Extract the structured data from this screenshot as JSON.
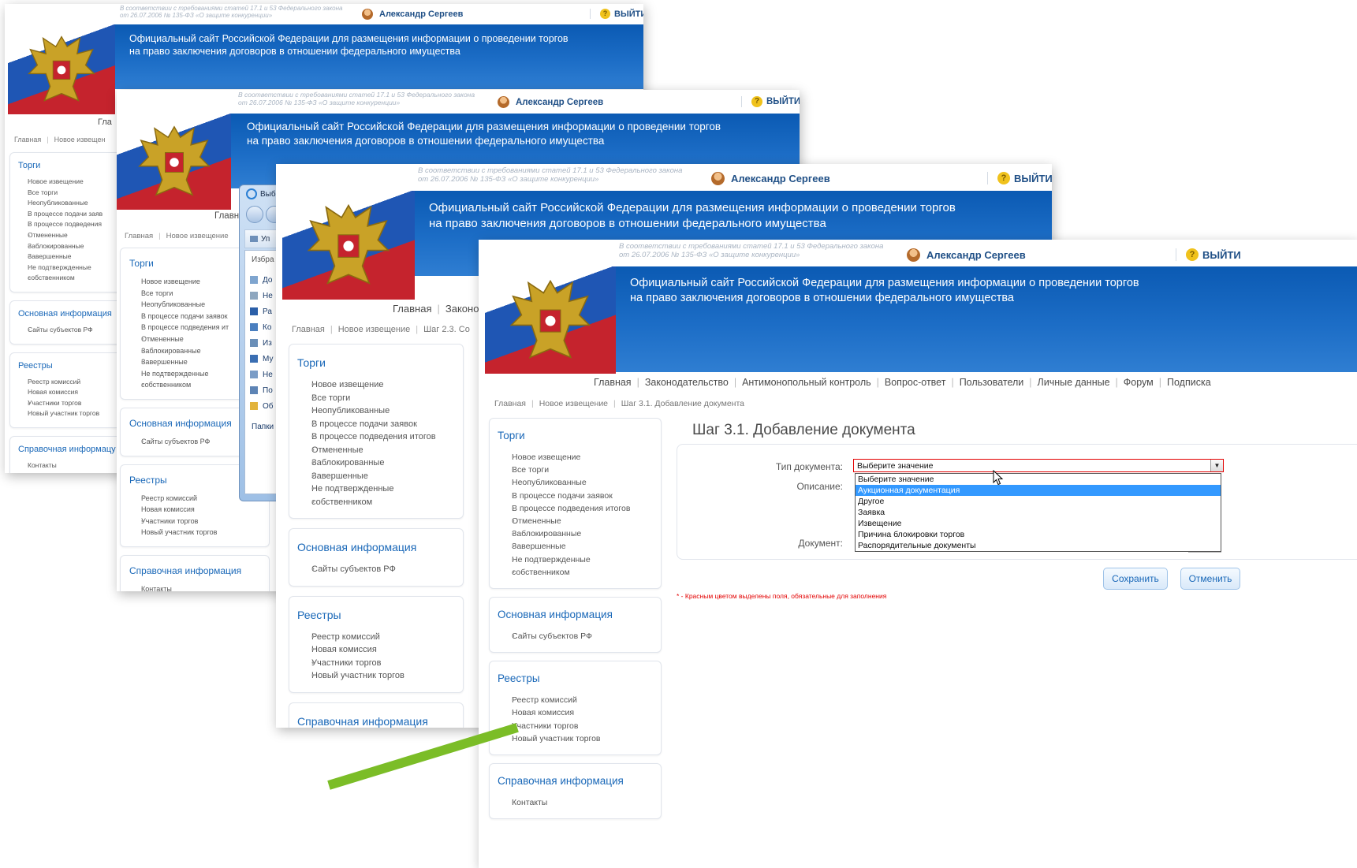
{
  "header": {
    "legal_line1": "В соответствии с требованиями статей 17.1 и 53 Федерального закона",
    "legal_line2": "от 26.07.2006 № 135-ФЗ «О защите конкуренции»",
    "user_name": "Александр Сергеев",
    "logout_label": "ВЫЙТИ",
    "title_line1": "Официальный сайт Российской Федерации для размещения информации о проведении торгов",
    "title_line2": "на право заключения договоров в отношении федерального имущества"
  },
  "nav": [
    "Главная",
    "Законодательство",
    "Антимонопольный контроль",
    "Вопрос-ответ",
    "Пользователи",
    "Личные данные",
    "Форум",
    "Подписка"
  ],
  "nav_partial": {
    "w1": "Гла",
    "w2": "Главн",
    "w3_a": "Главная",
    "w3_b": "Законо"
  },
  "breadcrumbs": {
    "home": "Главная",
    "notice": "Новое извещение",
    "w1_notice": "Новое извещен",
    "w2_notice": "Новое извещение",
    "w3_step": "Шаг 2.3. Со",
    "w4_step": "Шаг 3.1. Добавление документа"
  },
  "sidebar": {
    "torgi_title": "Торги",
    "torgi_items": [
      "Новое извещение",
      "Все торги",
      "Неопубликованные",
      "В процессе подачи заявок",
      "В процессе подведения итогов",
      "Отмененные",
      "Заблокированные",
      "Завершенные",
      "Не подтвержденные",
      "собственником"
    ],
    "info_title": "Основная информация",
    "info_items": [
      "Сайты субъектов РФ"
    ],
    "reestr_title": "Реестры",
    "reestr_items": [
      "Реестр комиссий",
      "Новая комиссия",
      "Участники торгов",
      "Новый участник торгов"
    ],
    "spravka_title": "Справочная информация",
    "spravka_items": [
      "Контакты"
    ]
  },
  "trunc": {
    "w1_submit": "В процессе подачи заяв",
    "w1_sum": "В процессе подведения",
    "w1_info": "Основная информация",
    "w1_spravka": "Справочная информацу",
    "w2_submit": "В процессе подачи заявок",
    "w2_sum": "В процессе подведения ит"
  },
  "dialog": {
    "title": "Выб",
    "toolbar": "Уп",
    "section": "Избра",
    "items": [
      "До",
      "Не",
      "Ра",
      "Ко",
      "Из",
      "Му",
      "Не",
      "По",
      "Об"
    ],
    "footer": "Папки"
  },
  "form": {
    "heading": "Шаг 3.1. Добавление документа",
    "type_label": "Тип документа:",
    "desc_label": "Описание:",
    "doc_label": "Документ:",
    "select_value": "Выберите значение",
    "options": [
      "Выберите значение",
      "Аукционная документация",
      "Другое",
      "Заявка",
      "Извещение",
      "Причина блокировки торгов",
      "Распорядительные документы"
    ],
    "highlighted_index": 1,
    "save_label": "Сохранить",
    "cancel_label": "Отменить",
    "required_note": "* - Красным цветом выделены поля, обязательные для заполнения"
  },
  "colors": {
    "accent": "#1a68b8",
    "banner": "#0b5ab3",
    "highlight": "#3399ff",
    "required": "#e30000",
    "green_stroke": "#7bbd27"
  }
}
